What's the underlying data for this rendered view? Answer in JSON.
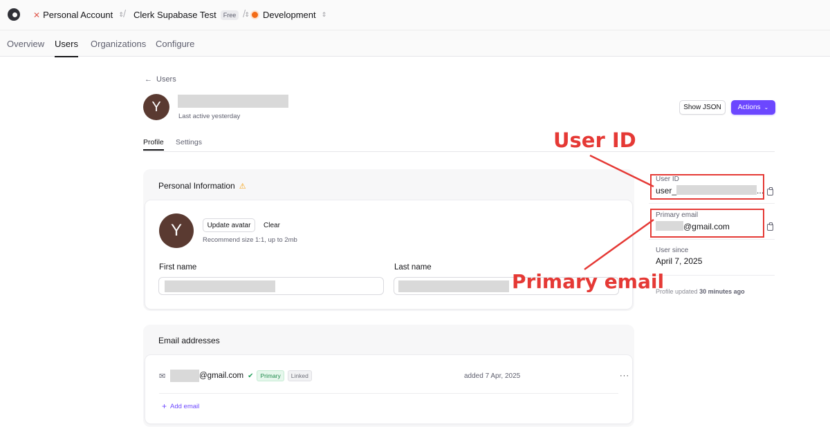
{
  "topbar": {
    "account": "Personal Account",
    "app": "Clerk Supabase Test",
    "plan_badge": "Free",
    "environment": "Development"
  },
  "nav": {
    "tabs": [
      "Overview",
      "Users",
      "Organizations",
      "Configure"
    ],
    "active": "Users"
  },
  "header": {
    "back_label": "Users",
    "avatar_initial": "Y",
    "last_active": "Last active yesterday",
    "show_json": "Show JSON",
    "actions": "Actions"
  },
  "subtabs": [
    "Profile",
    "Settings"
  ],
  "personal_info": {
    "title": "Personal Information",
    "avatar_initial": "Y",
    "update_avatar": "Update avatar",
    "clear": "Clear",
    "hint": "Recommend size 1:1, up to 2mb",
    "first_name_label": "First name",
    "last_name_label": "Last name"
  },
  "emails": {
    "title": "Email addresses",
    "address_suffix": "@gmail.com",
    "primary_badge": "Primary",
    "linked_badge": "Linked",
    "added": "added 7 Apr, 2025",
    "more": "···",
    "add_email": "Add email"
  },
  "sidebar": {
    "user_id_label": "User ID",
    "user_id_prefix": "user_",
    "user_id_ellipsis": "...",
    "primary_email_label": "Primary email",
    "primary_email_suffix": "@gmail.com",
    "user_since_label": "User since",
    "user_since": "April 7, 2025",
    "profile_updated_prefix": "Profile updated",
    "profile_updated_time": "30 minutes ago"
  },
  "annotations": {
    "user_id": "User ID",
    "primary_email": "Primary email",
    "color": "#e53935"
  },
  "colors": {
    "accent": "#6c47ff",
    "avatar": "#5a3a31",
    "success": "#22a05a",
    "warning": "#f59e0b"
  }
}
